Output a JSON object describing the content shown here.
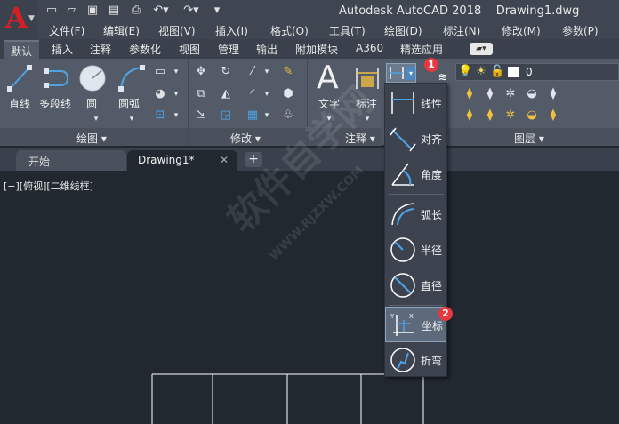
{
  "title_bar": {
    "app_name": "Autodesk AutoCAD 2018",
    "document": "Drawing1.dwg",
    "app_logo": "A",
    "quick_access": [
      "new-icon",
      "open-icon",
      "save-icon",
      "saveas-icon",
      "print-icon",
      "undo-icon",
      "redo-icon",
      "customize-icon"
    ]
  },
  "menu_bar": {
    "items": [
      "文件(F)",
      "编辑(E)",
      "视图(V)",
      "插入(I)",
      "格式(O)",
      "工具(T)",
      "绘图(D)",
      "标注(N)",
      "修改(M)",
      "参数(P)"
    ]
  },
  "ribbon_tabs": {
    "items": [
      "默认",
      "插入",
      "注释",
      "参数化",
      "视图",
      "管理",
      "输出",
      "附加模块",
      "A360",
      "精选应用"
    ],
    "active": "默认"
  },
  "ribbon": {
    "draw_panel": {
      "title": "绘图",
      "buttons": [
        "直线",
        "多段线",
        "圆",
        "圆弧"
      ]
    },
    "modify_panel": {
      "title": "修改"
    },
    "annotation_panel": {
      "title": "注释",
      "buttons": [
        "文字",
        "标注"
      ]
    },
    "layers_panel": {
      "title": "图层",
      "current_layer": "0"
    }
  },
  "doc_tabs": {
    "items": [
      "开始",
      "Drawing1*"
    ],
    "active": "Drawing1*",
    "add_label": "+"
  },
  "viewport": {
    "label": "[−][俯视][二维线框]"
  },
  "dimension_dropdown": {
    "items": [
      "线性",
      "对齐",
      "角度",
      "弧长",
      "半径",
      "直径",
      "坐标",
      "折弯"
    ],
    "highlighted": "坐标"
  },
  "callouts": [
    "1",
    "2"
  ],
  "watermark": {
    "text": "软件自学网",
    "url": "WWW.RJZXW.COM"
  },
  "colors": {
    "accent": "#d71f26",
    "background": "#212830",
    "ribbon": "#535b68",
    "icon_blue": "#4da3e6",
    "badge": "#e8373e"
  }
}
